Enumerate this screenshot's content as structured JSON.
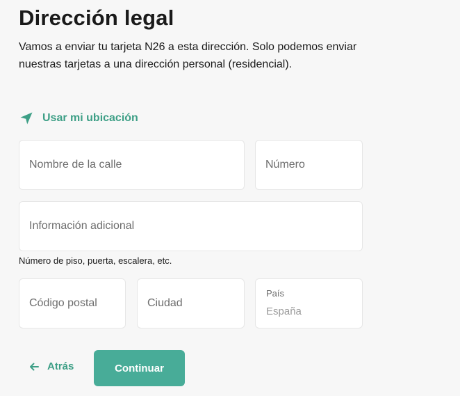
{
  "header": {
    "title": "Dirección legal",
    "description": "Vamos a enviar tu tarjeta N26 a esta dirección. Solo podemos enviar nuestras tarjetas a una dirección personal (residencial)."
  },
  "location": {
    "icon": "location-arrow-icon",
    "label": "Usar mi ubicación"
  },
  "form": {
    "street": {
      "placeholder": "Nombre de la calle",
      "value": ""
    },
    "number": {
      "placeholder": "Número",
      "value": ""
    },
    "additional": {
      "placeholder": "Información adicional",
      "value": "",
      "hint": "Número de piso, puerta, escalera, etc."
    },
    "postal_code": {
      "placeholder": "Código postal",
      "value": ""
    },
    "city": {
      "placeholder": "Ciudad",
      "value": ""
    },
    "country": {
      "label": "País",
      "value": "España"
    }
  },
  "actions": {
    "back_icon": "arrow-left-icon",
    "back_label": "Atrás",
    "continue_label": "Continuar"
  },
  "colors": {
    "accent": "#3d9f86",
    "button": "#48ac98",
    "background": "#f7f7f7",
    "field_background": "#ffffff"
  }
}
